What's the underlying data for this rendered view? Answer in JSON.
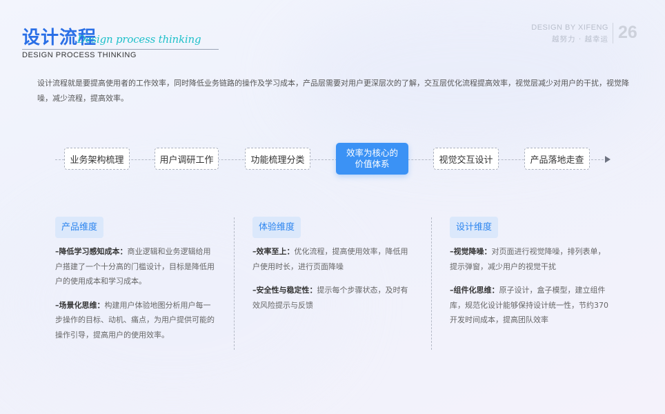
{
  "header": {
    "title_cn": "设计流程",
    "title_script": "Design process thinking",
    "title_en": "DESIGN PROCESS THINKING",
    "brand_en": "DESIGN BY XIFENG",
    "brand_cn": "越努力 · 越幸运",
    "page_number": "26"
  },
  "intro": "设计流程就是要提高使用者的工作效率，同时降低业务链路的操作及学习成本，产品层需要对用户更深层次的了解，交互层优化流程提高效率，视觉层减少对用户的干扰，视觉降噪，减少流程，提高效率。",
  "flow": {
    "steps": [
      "业务架构梳理",
      "用户调研工作",
      "功能梳理分类",
      "视觉交互设计",
      "产品落地走查"
    ],
    "core_line1": "效率为核心的",
    "core_line2": "价值体系",
    "accent_color": "#3b92f5"
  },
  "columns": [
    {
      "tag": "产品维度",
      "items": [
        {
          "head": "–降低学习感知成本：",
          "body": "商业逻辑和业务逻辑给用户搭建了一个十分高的门槛设计，目标是降低用户的使用成本和学习成本。"
        },
        {
          "head": "–场景化思维：",
          "body": "构建用户体验地图分析用户每一步操作的目标、动机、痛点，为用户提供可能的操作引导，提高用户的使用效率。"
        }
      ]
    },
    {
      "tag": "体验维度",
      "items": [
        {
          "head": "–效率至上：",
          "body": "优化流程，提高使用效率，降低用户使用时长，进行页面降噪"
        },
        {
          "head": "–安全性与稳定性：",
          "body": "提示每个步骤状态，及时有效风险提示与反馈"
        }
      ]
    },
    {
      "tag": "设计维度",
      "items": [
        {
          "head": "–视觉降噪：",
          "body": "对页面进行视觉降噪，排列表单，提示弹窗，减少用户的视觉干扰"
        },
        {
          "head": "–组件化思维：",
          "body": "原子设计，盒子模型，建立组件库，规范化设计能够保持设计统一性，节约370开发时间成本，提高团队效率"
        }
      ]
    }
  ]
}
